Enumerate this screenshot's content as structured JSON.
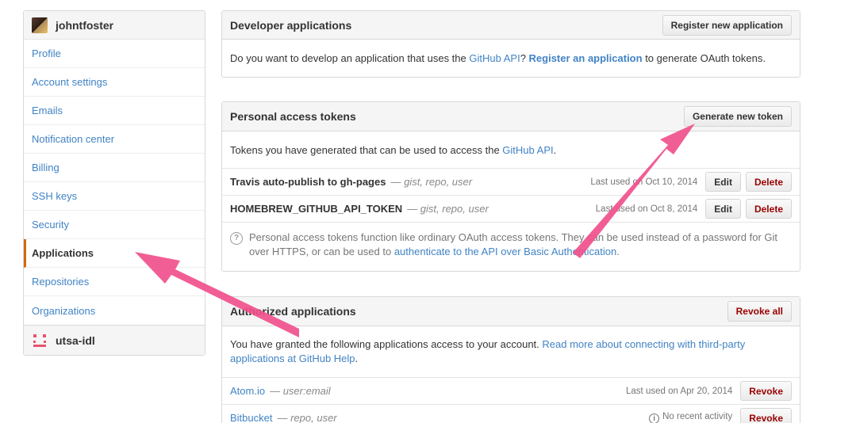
{
  "sidebar": {
    "user": "johntfoster",
    "items": [
      {
        "label": "Profile"
      },
      {
        "label": "Account settings"
      },
      {
        "label": "Emails"
      },
      {
        "label": "Notification center"
      },
      {
        "label": "Billing"
      },
      {
        "label": "SSH keys"
      },
      {
        "label": "Security"
      },
      {
        "label": "Applications"
      },
      {
        "label": "Repositories"
      },
      {
        "label": "Organizations"
      }
    ],
    "org": "utsa-idl"
  },
  "developer": {
    "title": "Developer applications",
    "button": "Register new application",
    "text_pre": "Do you want to develop an application that uses the ",
    "api_link": "GitHub API",
    "text_q": "? ",
    "register_link": "Register an application",
    "text_post": " to generate OAuth tokens."
  },
  "tokens": {
    "title": "Personal access tokens",
    "button": "Generate new token",
    "intro_pre": "Tokens you have generated that can be used to access the ",
    "intro_link": "GitHub API",
    "intro_post": ".",
    "edit_label": "Edit",
    "delete_label": "Delete",
    "rows": [
      {
        "name": "Travis auto-publish to gh-pages",
        "scopes": "— gist, repo, user",
        "last_used": "Last used on Oct 10, 2014"
      },
      {
        "name": "HOMEBREW_GITHUB_API_TOKEN",
        "scopes": "— gist, repo, user",
        "last_used": "Last used on Oct 8, 2014"
      }
    ],
    "note_text": "Personal access tokens function like ordinary OAuth access tokens. They can be used instead of a password for Git over HTTPS, or can be used to ",
    "note_link": "authenticate to the API over Basic Authentication",
    "note_end": "."
  },
  "authorized": {
    "title": "Authorized applications",
    "button": "Revoke all",
    "text": "You have granted the following applications access to your account. ",
    "link": "Read more about connecting with third-party applications at GitHub Help",
    "text_end": ".",
    "revoke_label": "Revoke",
    "apps": [
      {
        "name": "Atom.io",
        "scopes": "— user:email",
        "last_used": "Last used on Apr 20, 2014"
      },
      {
        "name": "Bitbucket",
        "scopes": "— repo, user",
        "last_used": "No recent activity"
      }
    ]
  },
  "colors": {
    "link": "#4183c4",
    "selected_marker": "#d26911",
    "danger": "#990000",
    "arrow": "#f0508c"
  }
}
